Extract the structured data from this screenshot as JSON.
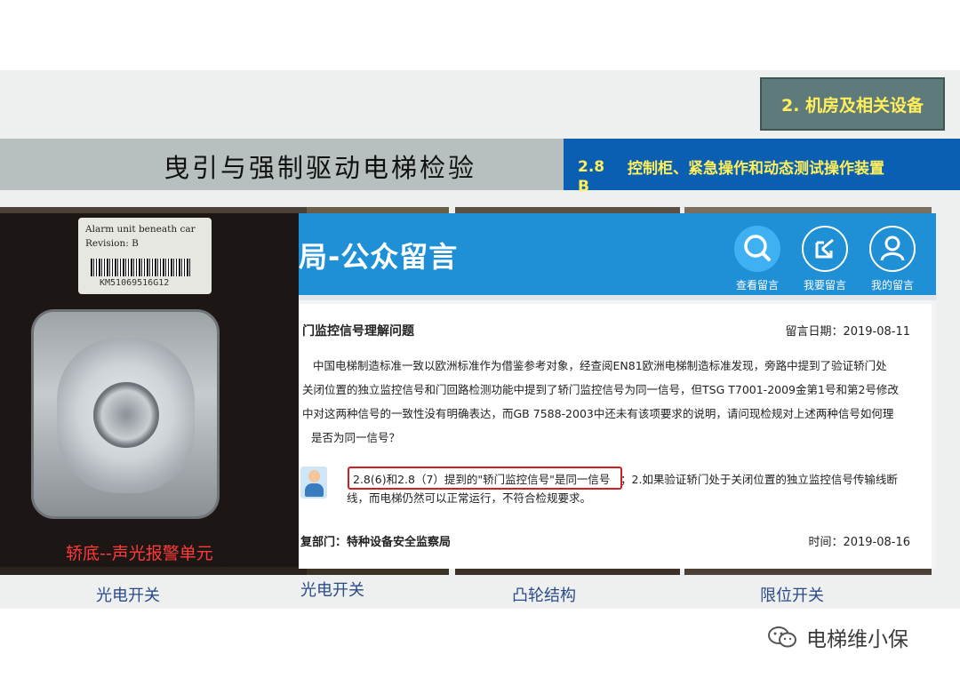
{
  "header": {
    "section_badge": "2. 机房及相关设备",
    "title": "曳引与强制驱动电梯检验",
    "clause_number": "2.8 B",
    "clause_title": "控制柜、紧急操作和动态测试操作装置"
  },
  "photo": {
    "tag_line1": "Alarm unit beneath car",
    "tag_line2": "Revision: B",
    "barcode_number": "KM51069516G12",
    "caption": "轿底--声光报警单元"
  },
  "panel": {
    "brand": "局-公众留言",
    "nav": [
      {
        "label": "查看留言",
        "icon": "search-icon"
      },
      {
        "label": "我要留言",
        "icon": "edit-icon"
      },
      {
        "label": "我的留言",
        "icon": "user-icon"
      }
    ],
    "message": {
      "subject": "门监控信号理解问题",
      "date": "留言日期：2019-08-11",
      "lines": [
        "中国电梯制造标准一致以欧洲标准作为借鉴参考对象，经查阅EN81欧洲电梯制造标准发现，旁路中提到了验证轿门处",
        "关闭位置的独立监控信号和门回路检测功能中提到了轿门监控信号为同一信号，但TSG T7001-2009金第1号和第2号修改",
        "中对这两种信号的一致性没有明确表达，而GB 7588-2003中还未有该项要求的说明，请问现检规对上述两种信号如何理",
        "是否为同一信号？"
      ],
      "reply_highlight": "2.8(6)和2.8（7）提到的\"轿门监控信号\"是同一信号",
      "reply_rest": "；2.如果验证轿门处于关闭位置的独立监控信号传输线断",
      "reply_line2": "线，而电梯仍然可以正常运行，不符合检规要求。",
      "department": "复部门：特种设备安全监察局",
      "reply_time": "时间：2019-08-16"
    }
  },
  "bottom_labels": [
    "光电开关",
    "光电开关",
    "凸轮结构",
    "限位开关"
  ],
  "watermark": "电梯维小保",
  "colors": {
    "accent_blue": "#1f8fd6",
    "badge_text": "#ffef5a",
    "caption_red": "#ff3a3a",
    "highlight_red": "#d11f1f"
  }
}
